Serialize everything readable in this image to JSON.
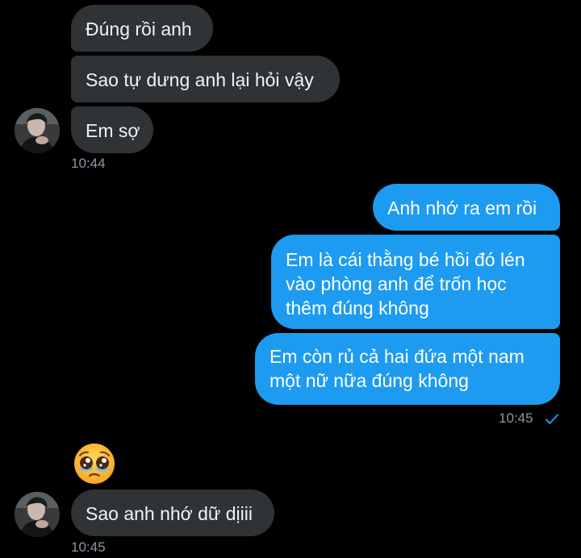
{
  "conversation": {
    "incoming_group_1": {
      "msg1": "Đúng rồi anh",
      "msg2": "Sao tự dưng anh lại hỏi vậy",
      "msg3": "Em sợ",
      "time": "10:44",
      "avatar_icon": "user-avatar-photo"
    },
    "outgoing_group": {
      "msg1": "Anh nhớ ra em rồi",
      "msg2_lines": [
        "Em là cái thằng bé hồi đó lén",
        "vào phòng anh để trốn học",
        "thêm đúng không"
      ],
      "msg3_lines": [
        "Em còn rủ cả hai đứa một nam",
        "một nữ nữa đúng không"
      ],
      "time": "10:45",
      "status_icon": "check-icon"
    },
    "incoming_group_2": {
      "emoji": "pleading-face-emoji",
      "msg1": "Sao anh nhớ dữ dịiii",
      "time": "10:45",
      "avatar_icon": "user-avatar-photo"
    }
  },
  "colors": {
    "background": "#000000",
    "incoming_bubble": "#2f3336",
    "outgoing_bubble": "#1d9bf0",
    "timestamp": "#8b98a5",
    "check": "#1d9bf0"
  }
}
